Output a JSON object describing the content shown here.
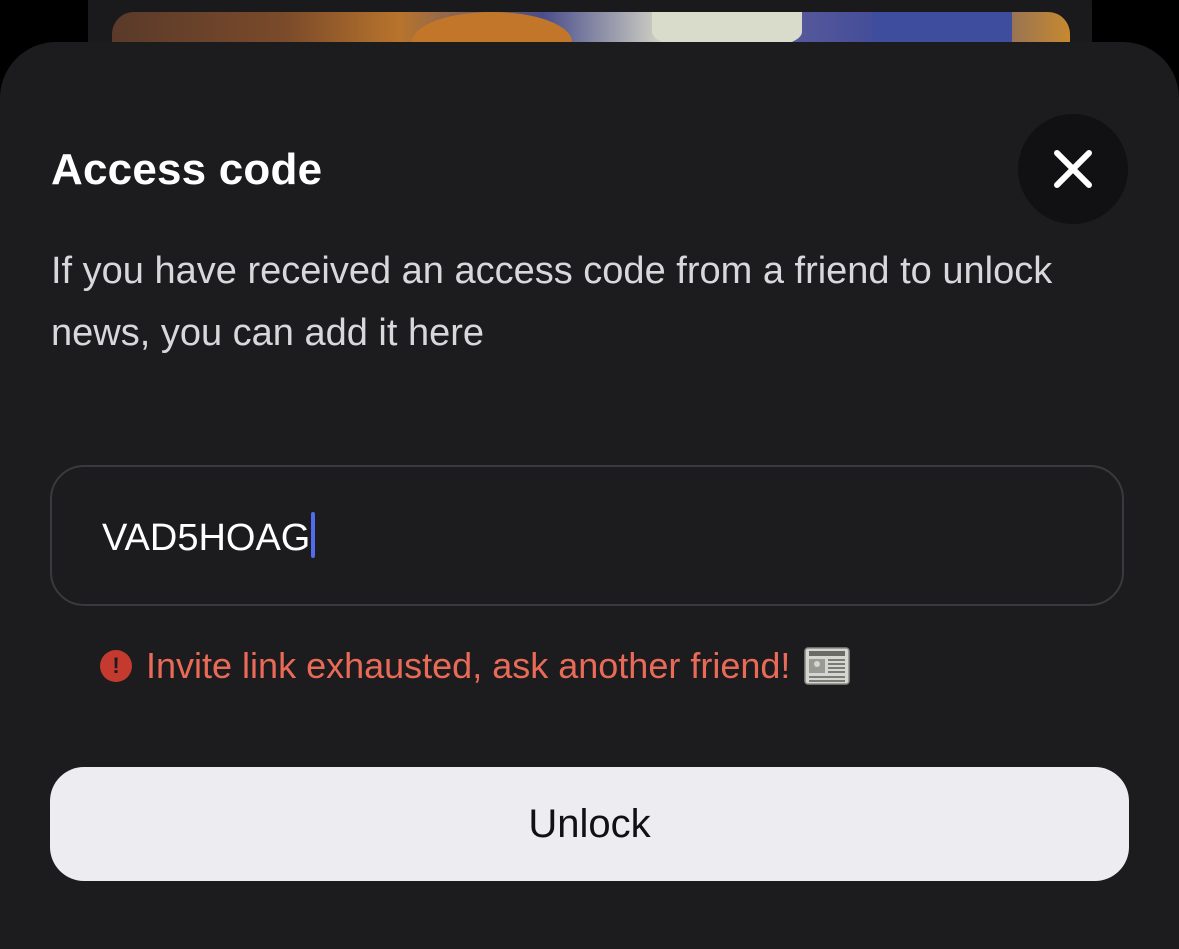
{
  "dialog": {
    "title": "Access code",
    "description": "If you have received an access code from a friend to unlock news, you can add it here",
    "close_icon": "close-icon"
  },
  "code_input": {
    "value": "VAD5HOAG"
  },
  "error": {
    "icon": "error-exclamation-icon",
    "message": "Invite link exhausted, ask another friend!",
    "emoji_icon": "newspaper-icon"
  },
  "actions": {
    "unlock_label": "Unlock"
  },
  "colors": {
    "sheet_background": "#1c1c1e",
    "error_text": "#ea6a58",
    "error_icon": "#c43a2f",
    "caret": "#4f6bf0",
    "button_background": "#ececf1"
  }
}
